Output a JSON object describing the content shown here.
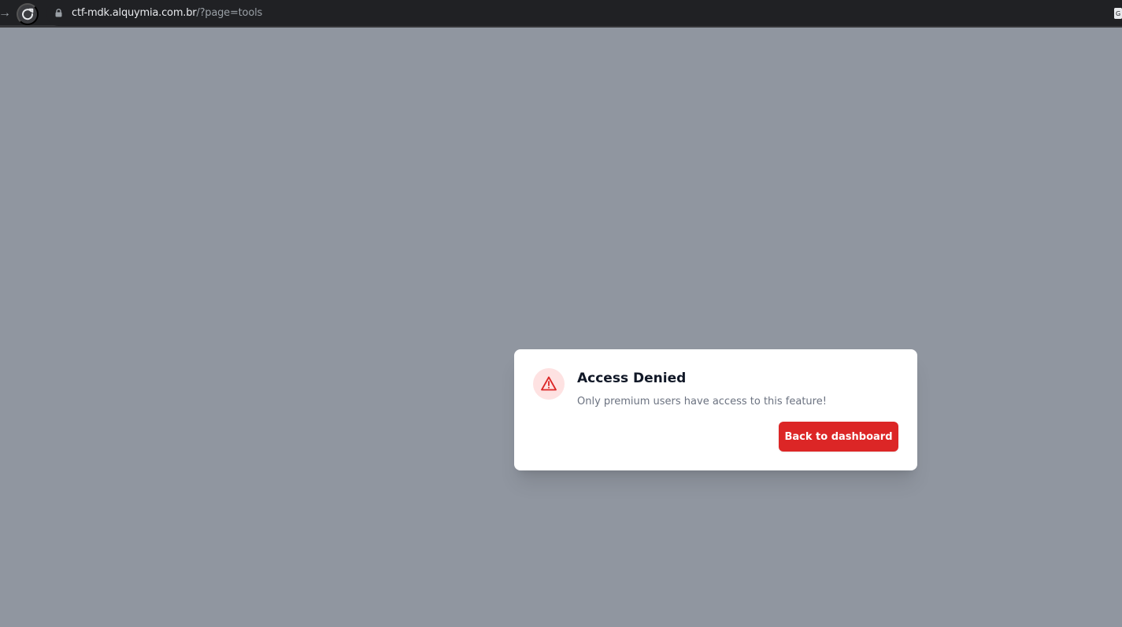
{
  "browser": {
    "url_host": "ctf-mdk.alquymia.com.br",
    "url_path": "/?page=tools",
    "icons": {
      "forward": "arrow-right-icon",
      "reload": "reload-icon",
      "secure": "lock-icon",
      "translate": "translate-icon"
    }
  },
  "dialog": {
    "icon": "warning-triangle-icon",
    "title": "Access Denied",
    "message": "Only premium users have access to this feature!",
    "button_label": "Back to dashboard"
  },
  "colors": {
    "browser_bar": "#202124",
    "overlay": "#9096a0",
    "accent_red": "#dc2626",
    "warning_bg": "#fee2e2",
    "title_text": "#111827",
    "message_text": "#6b7280"
  }
}
